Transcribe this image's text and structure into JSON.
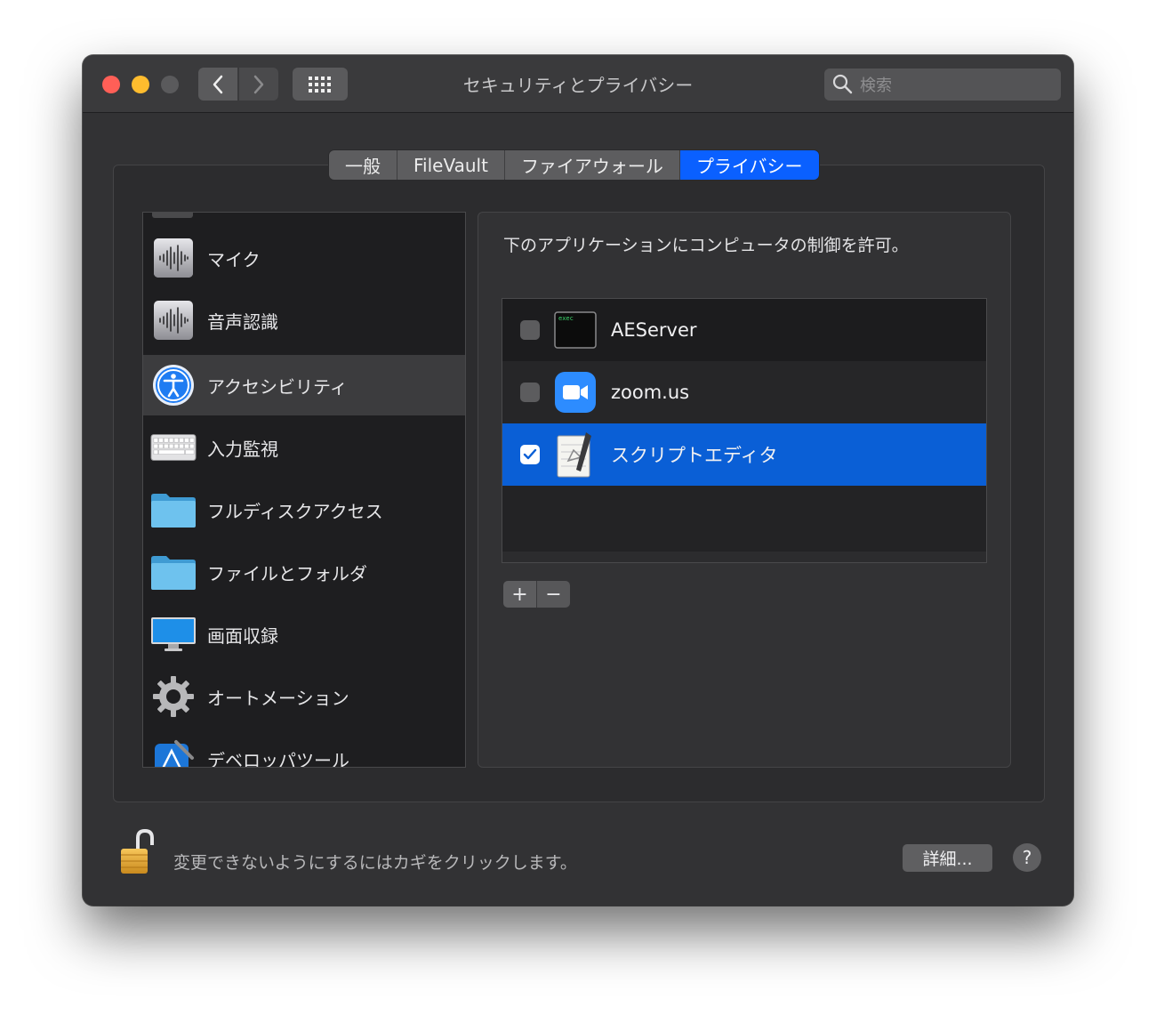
{
  "window": {
    "title": "セキュリティとプライバシー",
    "search_placeholder": "検索"
  },
  "tabs": [
    {
      "label": "一般",
      "active": false
    },
    {
      "label": "FileVault",
      "active": false
    },
    {
      "label": "ファイアウォール",
      "active": false
    },
    {
      "label": "プライバシー",
      "active": true
    }
  ],
  "sidebar": {
    "items": [
      {
        "label": "マイク",
        "icon": "microphone-waveform-icon"
      },
      {
        "label": "音声認識",
        "icon": "speech-waveform-icon"
      },
      {
        "label": "アクセシビリティ",
        "icon": "accessibility-icon",
        "selected": true
      },
      {
        "label": "入力監視",
        "icon": "keyboard-icon"
      },
      {
        "label": "フルディスクアクセス",
        "icon": "folder-icon"
      },
      {
        "label": "ファイルとフォルダ",
        "icon": "folder-icon"
      },
      {
        "label": "画面収録",
        "icon": "display-icon"
      },
      {
        "label": "オートメーション",
        "icon": "gear-icon"
      },
      {
        "label": "デベロッパツール",
        "icon": "xcode-icon"
      }
    ]
  },
  "main": {
    "description": "下のアプリケーションにコンピュータの制御を許可。",
    "apps": [
      {
        "name": "AEServer",
        "checked": false,
        "icon": "exec-terminal-icon",
        "icon_text": "exec"
      },
      {
        "name": "zoom.us",
        "checked": false,
        "icon": "zoom-icon"
      },
      {
        "name": "スクリプトエディタ",
        "checked": true,
        "selected": true,
        "icon": "script-editor-icon"
      }
    ],
    "add_label": "+",
    "remove_label": "−"
  },
  "footer": {
    "lock_text": "変更できないようにするにはカギをクリックします。",
    "advanced_label": "詳細...",
    "help_label": "?"
  },
  "colors": {
    "accent": "#0a60ff",
    "selected_row": "#0a5fd6",
    "window_bg": "#323234"
  }
}
